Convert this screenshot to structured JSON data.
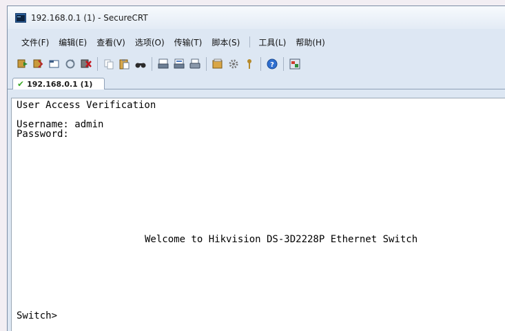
{
  "window": {
    "title": "192.168.0.1 (1) - SecureCRT"
  },
  "menu": [
    {
      "label": "文件(F)"
    },
    {
      "label": "编辑(E)"
    },
    {
      "label": "查看(V)"
    },
    {
      "label": "选项(O)"
    },
    {
      "label": "传输(T)"
    },
    {
      "label": "脚本(S)"
    },
    {
      "label": "工具(L)"
    },
    {
      "label": "帮助(H)"
    }
  ],
  "toolbar": {
    "icons": [
      "connect-icon",
      "quick-connect-icon",
      "connect-tab-icon",
      "reconnect-icon",
      "disconnect-icon",
      "copy-icon",
      "paste-icon",
      "find-icon",
      "print-icon",
      "print-selection-icon",
      "print-setup-icon",
      "session-options-icon",
      "global-options-icon",
      "keymap-icon",
      "help-icon",
      "sftp-icon"
    ]
  },
  "tab": {
    "label": "192.168.0.1 (1)",
    "status_icon": "check-icon",
    "status_color": "#3faa2b"
  },
  "terminal": {
    "lines": {
      "l1": "User Access Verification",
      "l2": "Username: admin",
      "l3": "Password:",
      "l4": "Welcome to Hikvision DS-3D2228P Ethernet Switch",
      "l5": "Switch>"
    }
  }
}
